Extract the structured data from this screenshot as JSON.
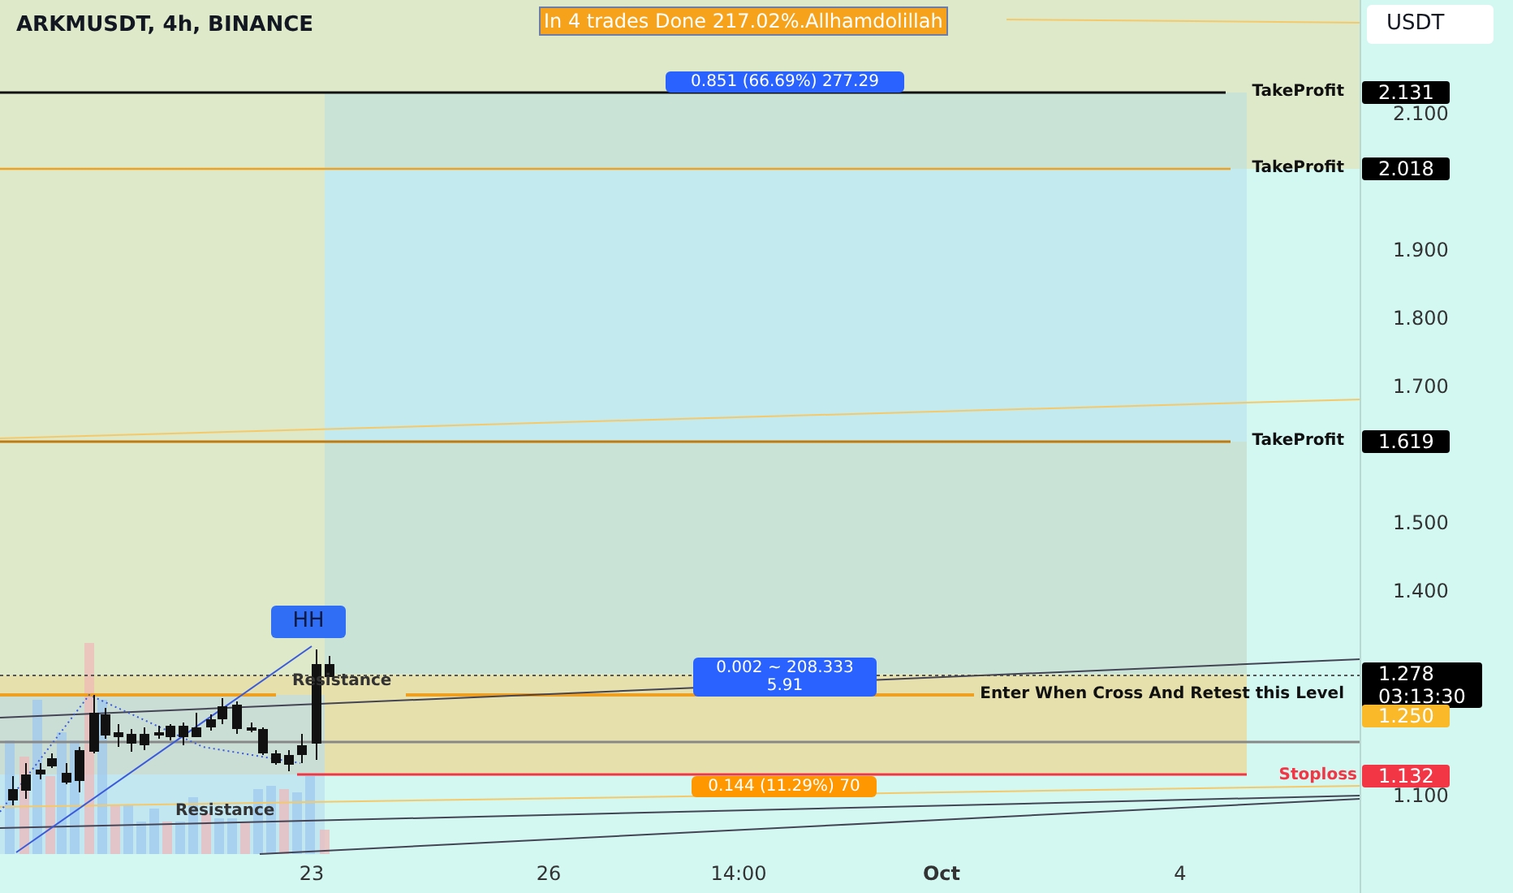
{
  "symbol": {
    "title": "ARKMUSDT, 4h, BINANCE"
  },
  "banner": {
    "text": "In 4 trades Done 217.02%.Allhamdolillah"
  },
  "currency": {
    "label": "USDT"
  },
  "measure_labels": [
    {
      "text": "0.851 (66.69%) 277.29",
      "color": "#2962ff"
    },
    {
      "text": "0.002 ~ 208.333\n5.91",
      "color": "#2962ff"
    },
    {
      "text": "0.144 (11.29%) 70",
      "color": "#ff9800"
    }
  ],
  "pivot_label": {
    "text": "HH"
  },
  "chart_texts": [
    {
      "text": "Resistance"
    },
    {
      "text": "Resistance"
    },
    {
      "text": "TakeProfit"
    },
    {
      "text": "TakeProfit"
    },
    {
      "text": "TakeProfit"
    },
    {
      "text": "Enter When Cross And Retest this Level"
    },
    {
      "text": "Stoploss"
    }
  ],
  "price_tags": [
    {
      "text": "2.131",
      "color": "#000000"
    },
    {
      "text": "2.018",
      "color": "#000000"
    },
    {
      "text": "1.619",
      "color": "#000000"
    },
    {
      "text": "1.278\n03:13:30",
      "color": "#000000"
    },
    {
      "text": "1.250",
      "color": "#f9b928"
    },
    {
      "text": "1.132",
      "color": "#f23645"
    }
  ],
  "price_axis": [
    "2.100",
    "1.900",
    "1.800",
    "1.700",
    "1.500",
    "1.400",
    "1.100"
  ],
  "time_axis": [
    "23",
    "26",
    "14:00",
    "Oct",
    "4"
  ]
}
